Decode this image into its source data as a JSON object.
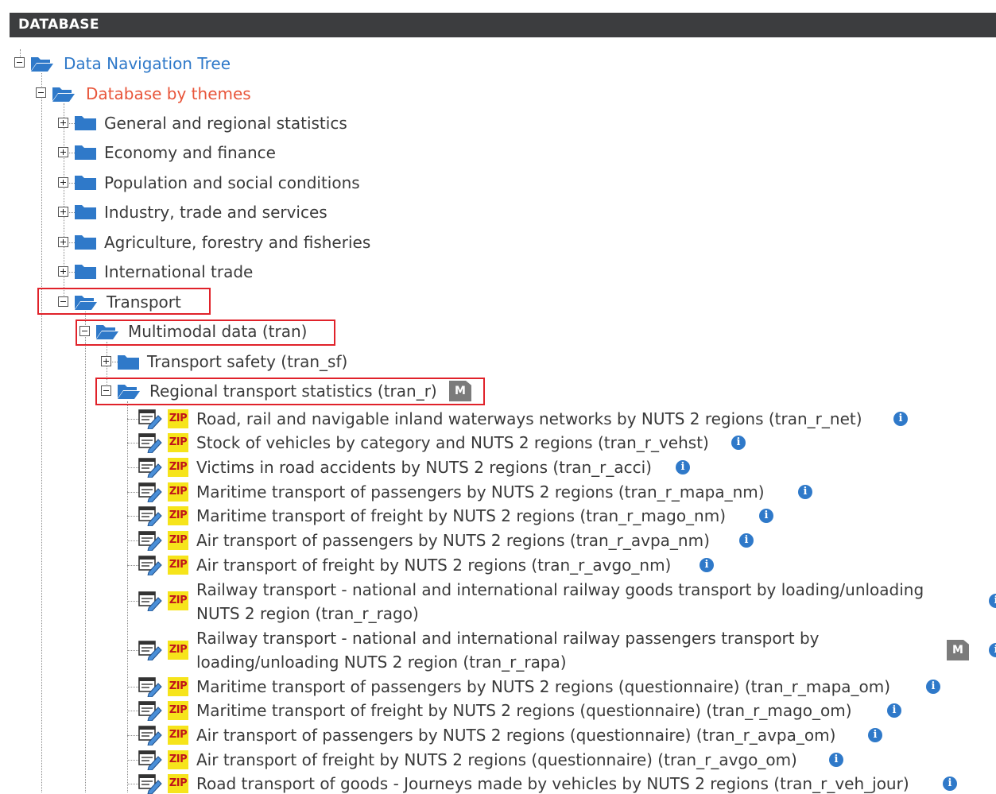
{
  "header": {
    "title": "DATABASE"
  },
  "tree": {
    "root": "Data Navigation Tree",
    "themes": "Database by themes",
    "folders": [
      "General and regional statistics",
      "Economy and finance",
      "Population and social conditions",
      "Industry, trade and services",
      "Agriculture, forestry and fisheries",
      "International trade",
      "Transport"
    ],
    "multimodal": "Multimodal data (tran)",
    "safety": "Transport safety (tran_sf)",
    "regional": "Regional transport statistics (tran_r)",
    "badge_m": "M",
    "zip_label": "ZIP",
    "info_glyph": "i",
    "datasets": [
      "Road, rail and navigable inland waterways networks by NUTS 2 regions (tran_r_net)",
      "Stock of vehicles by category and NUTS 2 regions (tran_r_vehst)",
      "Victims in road accidents by NUTS 2 regions (tran_r_acci)",
      "Maritime transport of passengers by NUTS 2 regions (tran_r_mapa_nm)",
      "Maritime transport of freight by NUTS 2 regions (tran_r_mago_nm)",
      "Air transport of passengers by NUTS 2 regions (tran_r_avpa_nm)",
      "Air transport of freight by NUTS 2 regions (tran_r_avgo_nm)",
      "Railway transport - national and international railway goods transport by loading/unloading NUTS 2 region (tran_r_rago)",
      "Railway transport - national and international railway passengers transport by loading/unloading NUTS 2 region (tran_r_rapa)",
      "Maritime transport of passengers by NUTS 2 regions (questionnaire) (tran_r_mapa_om)",
      "Maritime transport of freight by NUTS 2 regions (questionnaire) (tran_r_mago_om)",
      "Air transport of passengers by NUTS 2 regions (questionnaire) (tran_r_avpa_om)",
      "Air transport of freight by NUTS 2 regions (questionnaire) (tran_r_avgo_om)",
      "Road transport of goods - Journeys made by vehicles by NUTS 2 regions (tran_r_veh_jour)"
    ]
  },
  "colors": {
    "link_blue": "#2f79c9",
    "highlight_orange": "#e8553a",
    "red_box": "#e0222a",
    "header_bg": "#3c3d3f"
  }
}
